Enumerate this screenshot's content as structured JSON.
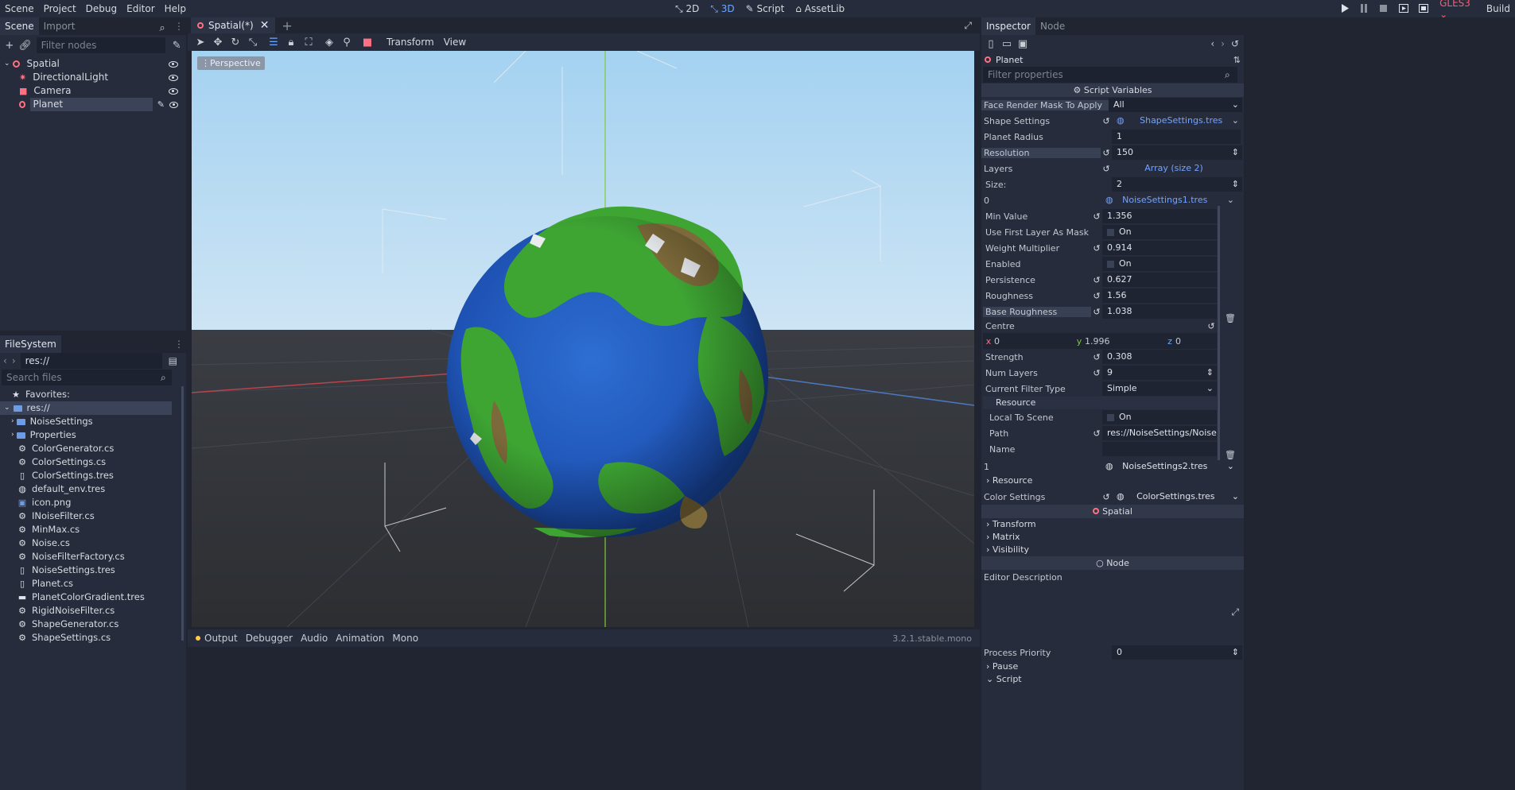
{
  "menubar": {
    "menus": [
      "Scene",
      "Project",
      "Debug",
      "Editor",
      "Help"
    ],
    "modes": [
      {
        "label": "2D",
        "icon": "2d-icon",
        "active": false
      },
      {
        "label": "3D",
        "icon": "3d-icon",
        "active": true
      },
      {
        "label": "Script",
        "icon": "script-icon",
        "active": false
      },
      {
        "label": "AssetLib",
        "icon": "assetlib-icon",
        "active": false
      }
    ],
    "renderer": "GLES3",
    "build_label": "Build"
  },
  "scene_panel": {
    "tabs": [
      "Scene",
      "Import"
    ],
    "filter_placeholder": "Filter nodes",
    "nodes": [
      {
        "label": "Spatial",
        "icon": "spatial-node-icon",
        "depth": 0
      },
      {
        "label": "DirectionalLight",
        "icon": "light-icon",
        "depth": 1
      },
      {
        "label": "Camera",
        "icon": "camera-icon",
        "depth": 1
      },
      {
        "label": "Planet",
        "icon": "spatial-node-icon",
        "depth": 1,
        "selected": true
      }
    ]
  },
  "filesystem": {
    "tab": "FileSystem",
    "path": "res://",
    "search_placeholder": "Search files",
    "favorites_label": "Favorites:",
    "items": [
      {
        "label": "res://",
        "type": "folder",
        "depth": 0,
        "selected": true
      },
      {
        "label": "NoiseSettings",
        "type": "folder",
        "depth": 1
      },
      {
        "label": "Properties",
        "type": "folder",
        "depth": 1
      },
      {
        "label": "ColorGenerator.cs",
        "type": "script",
        "depth": 1
      },
      {
        "label": "ColorSettings.cs",
        "type": "script",
        "depth": 1
      },
      {
        "label": "ColorSettings.tres",
        "type": "resource",
        "depth": 1
      },
      {
        "label": "default_env.tres",
        "type": "env",
        "depth": 1
      },
      {
        "label": "icon.png",
        "type": "image",
        "depth": 1
      },
      {
        "label": "INoiseFilter.cs",
        "type": "script",
        "depth": 1
      },
      {
        "label": "MinMax.cs",
        "type": "script",
        "depth": 1
      },
      {
        "label": "Noise.cs",
        "type": "script",
        "depth": 1
      },
      {
        "label": "NoiseFilterFactory.cs",
        "type": "script",
        "depth": 1
      },
      {
        "label": "NoiseSettings.tres",
        "type": "resource",
        "depth": 1
      },
      {
        "label": "Planet.cs",
        "type": "resource",
        "depth": 1
      },
      {
        "label": "PlanetColorGradient.tres",
        "type": "gradient",
        "depth": 1
      },
      {
        "label": "RigidNoiseFilter.cs",
        "type": "script",
        "depth": 1
      },
      {
        "label": "ShapeGenerator.cs",
        "type": "script",
        "depth": 1
      },
      {
        "label": "ShapeSettings.cs",
        "type": "script",
        "depth": 1
      }
    ]
  },
  "editor_tabs": {
    "open_tab": "Spatial(*)"
  },
  "viewport_toolbar": {
    "menus": [
      "Transform",
      "View"
    ],
    "perspective_label": "Perspective"
  },
  "bottom_panel": {
    "tabs": [
      "Output",
      "Debugger",
      "Audio",
      "Animation",
      "Mono"
    ],
    "version": "3.2.1.stable.mono"
  },
  "inspector": {
    "tabs": [
      "Inspector",
      "Node"
    ],
    "object_name": "Planet",
    "filter_placeholder": "Filter properties",
    "script_variables_label": "Script Variables",
    "face_render_mask": {
      "name": "Face Render Mask To Apply",
      "value": "All"
    },
    "shape_settings": {
      "name": "Shape Settings",
      "value": "ShapeSettings.tres"
    },
    "planet_radius": {
      "name": "Planet Radius",
      "value": "1"
    },
    "resolution": {
      "name": "Resolution",
      "value": "150"
    },
    "layers": {
      "name": "Layers",
      "value": "Array (size 2)"
    },
    "size": {
      "name": "Size:",
      "value": "2"
    },
    "layer0": {
      "index": "0",
      "value": "NoiseSettings1.tres"
    },
    "min_value": {
      "name": "Min Value",
      "value": "1.356"
    },
    "use_first_layer": {
      "name": "Use First Layer As Mask",
      "value": "On"
    },
    "weight_multiplier": {
      "name": "Weight Multiplier",
      "value": "0.914"
    },
    "enabled": {
      "name": "Enabled",
      "value": "On"
    },
    "persistence": {
      "name": "Persistence",
      "value": "0.627"
    },
    "roughness": {
      "name": "Roughness",
      "value": "1.56"
    },
    "base_roughness": {
      "name": "Base Roughness",
      "value": "1.038"
    },
    "centre": {
      "name": "Centre",
      "x_label": "x",
      "x": "0",
      "y_label": "y",
      "y": "1.996",
      "z_label": "z",
      "z": "0"
    },
    "strength": {
      "name": "Strength",
      "value": "0.308"
    },
    "num_layers": {
      "name": "Num Layers",
      "value": "9"
    },
    "filter_type": {
      "name": "Current Filter Type",
      "value": "Simple"
    },
    "resource_label": "Resource",
    "local_to_scene": {
      "name": "Local To Scene",
      "value": "On"
    },
    "path": {
      "name": "Path",
      "value": "res://NoiseSettings/NoiseSetti"
    },
    "name_field": {
      "name": "Name",
      "value": ""
    },
    "layer1": {
      "index": "1",
      "value": "NoiseSettings2.tres"
    },
    "resource2_label": "Resource",
    "color_settings": {
      "name": "Color Settings",
      "value": "ColorSettings.tres"
    },
    "spatial_section": "Spatial",
    "spatial_groups": [
      "Transform",
      "Matrix",
      "Visibility"
    ],
    "node_section": "Node",
    "editor_description": "Editor Description",
    "process_priority": {
      "name": "Process Priority",
      "value": "0"
    },
    "bottom_groups": [
      "Pause",
      "Script"
    ]
  }
}
